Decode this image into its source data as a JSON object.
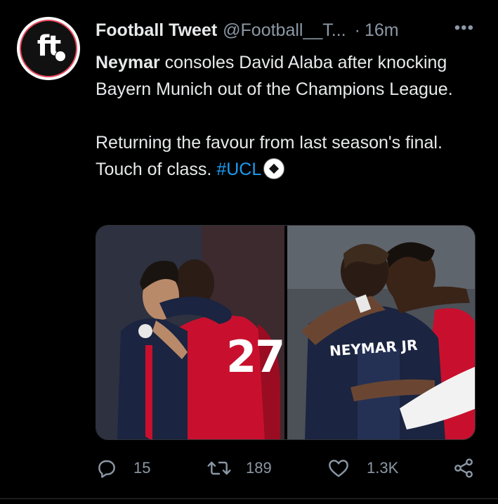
{
  "tweet": {
    "display_name": "Football Tweet",
    "handle": "@Football__T...",
    "separator": "·",
    "time": "16m",
    "more": "•••",
    "avatar_logo": "ft",
    "text": {
      "line1_bold": "Neymar",
      "line1_rest": " consoles David Alaba after knocking Bayern Munich out of the Champions League.",
      "line2_text": "Returning the favour from last season's final. Touch of class. ",
      "hashtag": "#UCL",
      "emoji": "soccer-ball-emoji"
    },
    "media": {
      "left_photo": {
        "jersey_number": "27"
      },
      "right_photo": {
        "jersey_name": "NEYMAR JR"
      }
    },
    "actions": {
      "reply_count": "15",
      "retweet_count": "189",
      "like_count": "1.3K",
      "icons": [
        "reply-icon",
        "retweet-icon",
        "like-icon",
        "share-icon"
      ]
    }
  },
  "colors": {
    "background": "#000000",
    "text": "#e7e9ea",
    "secondary": "#8b98a5",
    "hashtag": "#1d9bf0",
    "avatar_ring": "#e8475c"
  }
}
